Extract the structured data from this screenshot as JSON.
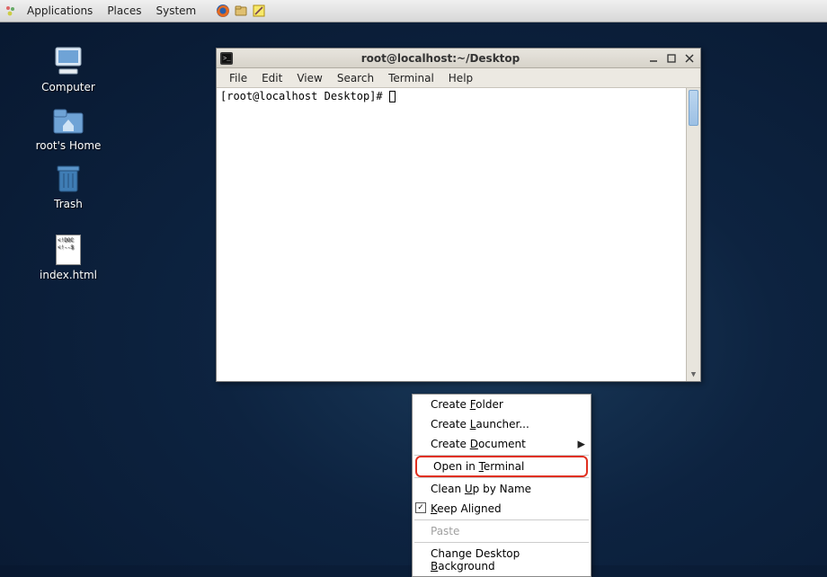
{
  "panel": {
    "applications": "Applications",
    "places": "Places",
    "system": "System"
  },
  "desktop_icons": {
    "computer": "Computer",
    "home": "root's Home",
    "trash": "Trash",
    "index": "index.html",
    "index_preview_line1": "<!DOC",
    "index_preview_line2": "<!--$"
  },
  "terminal": {
    "title": "root@localhost:~/Desktop",
    "menubar": {
      "file": "File",
      "edit": "Edit",
      "view": "View",
      "search": "Search",
      "terminal": "Terminal",
      "help": "Help"
    },
    "prompt": "[root@localhost Desktop]# "
  },
  "context_menu": {
    "create_folder_pre": "Create ",
    "create_folder_u": "F",
    "create_folder_post": "older",
    "create_launcher_pre": "Create ",
    "create_launcher_u": "L",
    "create_launcher_post": "auncher...",
    "create_document_pre": "Create ",
    "create_document_u": "D",
    "create_document_post": "ocument",
    "open_terminal_pre": "Open in ",
    "open_terminal_u": "T",
    "open_terminal_post": "erminal",
    "clean_up_pre": "Clean ",
    "clean_up_u": "U",
    "clean_up_post": "p by Name",
    "keep_aligned_u": "K",
    "keep_aligned_post": "eep Aligned",
    "paste": "Paste",
    "change_bg_pre": "Change Desktop ",
    "change_bg_u": "B",
    "change_bg_post": "ackground"
  }
}
